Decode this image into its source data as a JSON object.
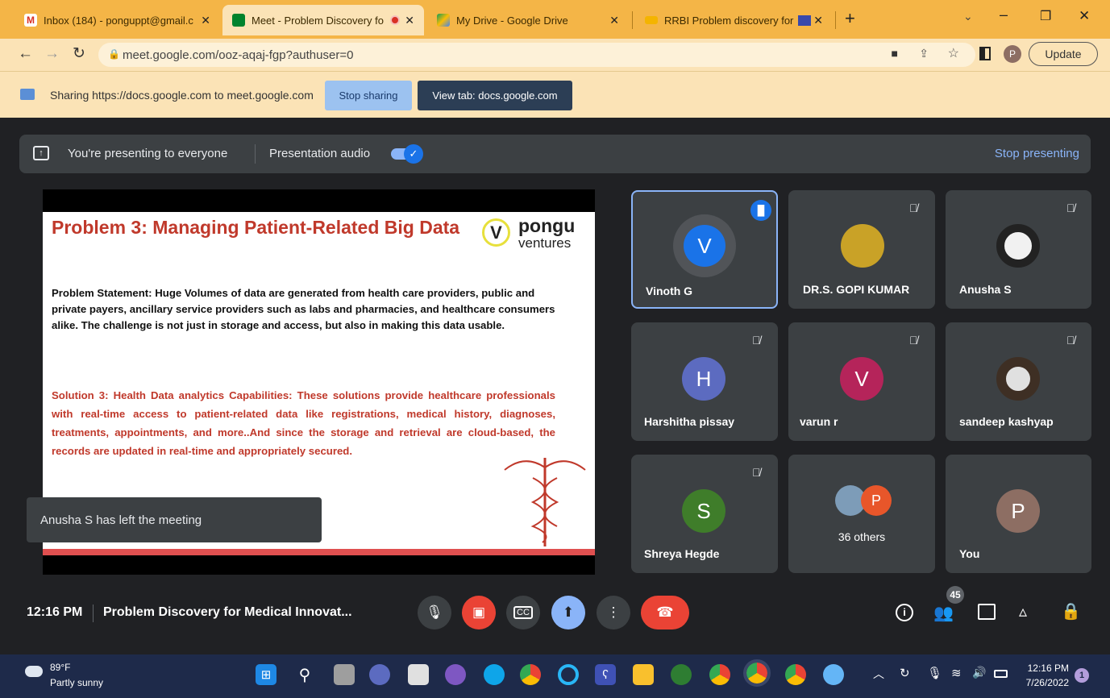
{
  "browser": {
    "tabs": [
      {
        "label": "Inbox (184) - ponguppt@gmail.c",
        "icon": "gmail-icon",
        "color": "#d93025"
      },
      {
        "label": "Meet - Problem Discovery fo",
        "icon": "meet-icon",
        "color": "#00832d"
      },
      {
        "label": "My Drive - Google Drive",
        "icon": "drive-icon",
        "color": "#fbbc04"
      },
      {
        "label": "RRBI Problem discovery for",
        "icon": "slides-icon",
        "color": "#f4b400"
      }
    ],
    "url": "meet.google.com/ooz-aqaj-fgp?authuser=0",
    "update_label": "Update",
    "profile_letter": "P"
  },
  "sharing_bar": {
    "text": "Sharing https://docs.google.com to meet.google.com",
    "stop_label": "Stop sharing",
    "view_label": "View tab: docs.google.com"
  },
  "presenting_bar": {
    "text": "You're presenting to everyone",
    "audio_label": "Presentation audio",
    "stop_label": "Stop presenting"
  },
  "slide": {
    "title": "Problem 3: Managing Patient-Related Big Data",
    "logo_line1": "pongu",
    "logo_line2": "ventures",
    "problem": "Problem Statement: Huge Volumes of data are generated from health care providers, public and private payers, ancillary service providers such as labs and pharmacies, and healthcare consumers alike. The challenge is not just in storage and access, but also in making this data usable.",
    "solution": "Solution 3: Health Data analytics Capabilities: These solutions provide healthcare professionals with real-time access to patient-related data like registrations, medical history, diagnoses, treatments, appointments, and more..And since the storage and retrieval are cloud-based, the records are updated in real-time and appropriately secured."
  },
  "toast": "Anusha S has left the meeting",
  "participants": [
    {
      "name": "Vinoth G",
      "letter": "V",
      "color": "#1a73e8"
    },
    {
      "name": "DR.S. GOPI KUMAR",
      "letter": "",
      "color": "#c9a227"
    },
    {
      "name": "Anusha S",
      "letter": "",
      "color": "#f1f1f1"
    },
    {
      "name": "Harshitha pissay",
      "letter": "H",
      "color": "#5c6bc0"
    },
    {
      "name": "varun r",
      "letter": "V",
      "color": "#b5245a"
    },
    {
      "name": "sandeep kashyap",
      "letter": "",
      "color": "#e0e0e0"
    },
    {
      "name": "Shreya Hegde",
      "letter": "S",
      "color": "#3f7d2a"
    },
    {
      "name": "36 others",
      "letter": "P",
      "color": "#e8562a"
    },
    {
      "name": "You",
      "letter": "P",
      "color": "#8d6e63"
    }
  ],
  "bottom": {
    "time": "12:16 PM",
    "meeting_title": "Problem Discovery for Medical Innovat...",
    "people_count": "45"
  },
  "taskbar": {
    "temp": "89°F",
    "weather": "Partly sunny",
    "clock_time": "12:16 PM",
    "clock_date": "7/26/2022",
    "notif_count": "1"
  }
}
